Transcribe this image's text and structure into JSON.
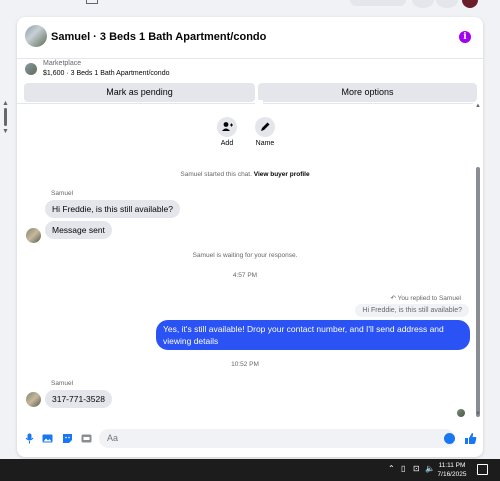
{
  "header": {
    "title": "Samuel · 3 Beds 1 Bath Apartment/condo",
    "info_glyph": "i",
    "accent_color": "#a100f2"
  },
  "marketplace": {
    "label": "Marketplace",
    "listing": "$1,600 · 3 Beds 1 Bath Apartment/condo",
    "mark_pending": "Mark as pending",
    "more_options": "More options"
  },
  "actions": {
    "add_label": "Add",
    "name_label": "Name"
  },
  "conversation": {
    "started_prefix": "Samuel started this chat.",
    "view_profile": "View buyer profile",
    "sender1": "Samuel",
    "msg1": "Hi Freddie, is this still available?",
    "msg2": "Message sent",
    "waiting": "Samuel is waiting for your response.",
    "time1": "4:57 PM",
    "replied_to": "You replied to Samuel",
    "quoted": "Hi Freddie, is this still available?",
    "reply": "Yes, it's still available! Drop your contact number, and I'll send address and viewing details",
    "time2": "10:52 PM",
    "sender2": "Samuel",
    "msg3": "317-771-3528",
    "outgoing_color": "#2a52f5"
  },
  "composer": {
    "placeholder": "Aa",
    "icons": [
      "microphone-icon",
      "photo-icon",
      "sticker-icon",
      "gif-icon",
      "emoji-icon",
      "like-icon"
    ]
  },
  "taskbar": {
    "time": "11:11 PM",
    "date": "7/16/2025"
  }
}
